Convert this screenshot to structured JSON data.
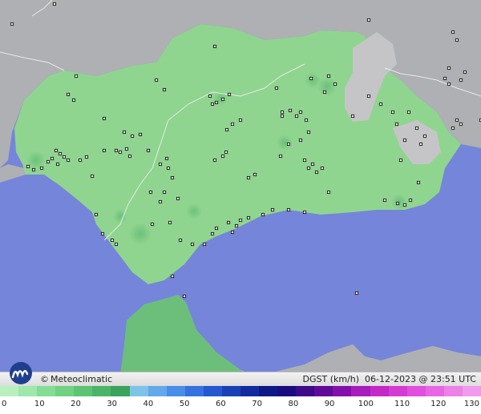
{
  "brand": {
    "copyright": "©",
    "name": "Meteoclimatic",
    "logo_icon": "meteoclimatic-logo-icon"
  },
  "stamp": {
    "variable": "DGST (km/h)",
    "date": "06-12-2023",
    "at": "@",
    "time": "23:51 UTC"
  },
  "scale": {
    "unit": "km/h",
    "tick_labels": [
      "0",
      "10",
      "20",
      "30",
      "40",
      "50",
      "60",
      "70",
      "80",
      "90",
      "100",
      "110",
      "120",
      "130"
    ],
    "colors": [
      "#b8f0c0",
      "#9ee8ab",
      "#84dd96",
      "#6fd283",
      "#5cc472",
      "#4bb466",
      "#3aa45c",
      "#7ec3e8",
      "#63a8ea",
      "#4a8de8",
      "#3572e0",
      "#2458d0",
      "#1a40b8",
      "#122aa0",
      "#0d1888",
      "#1a0b80",
      "#3d0a8a",
      "#600a9a",
      "#8410ac",
      "#a81bbc",
      "#c428c8",
      "#d63ad4",
      "#e04fde",
      "#e866e4",
      "#ee80ea",
      "#f29aee"
    ]
  },
  "map": {
    "sea_color": "#7585d9",
    "land_color": "#aeb0b3",
    "region_color": "#8fd58f",
    "high_terrain_color": "#c5c5c7"
  }
}
